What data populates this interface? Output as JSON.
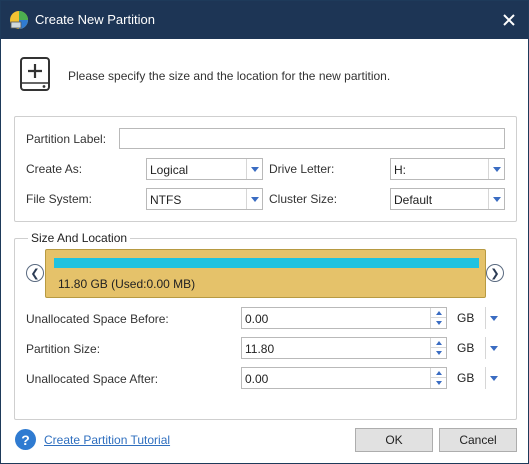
{
  "window": {
    "title": "Create New Partition",
    "close_icon": "close-icon",
    "title_icon": "partition-wizard-icon"
  },
  "header": {
    "icon": "add-disk-icon",
    "text": "Please specify the size and the location for the new partition."
  },
  "settings": {
    "partition_label_label": "Partition Label:",
    "partition_label_value": "",
    "create_as_label": "Create As:",
    "create_as_value": "Logical",
    "drive_letter_label": "Drive Letter:",
    "drive_letter_value": "H:",
    "file_system_label": "File System:",
    "file_system_value": "NTFS",
    "cluster_size_label": "Cluster Size:",
    "cluster_size_value": "Default"
  },
  "size_location": {
    "legend": "Size And Location",
    "partition_info": "11.80 GB (Used:0.00 MB)",
    "used_fraction": 1.0,
    "bar_color": "#1fc2e0",
    "box_color": "#e5c26a",
    "unallocated_before_label": "Unallocated Space Before:",
    "unallocated_before_value": "0.00",
    "unallocated_before_unit": "GB",
    "partition_size_label": "Partition Size:",
    "partition_size_value": "11.80",
    "partition_size_unit": "GB",
    "unallocated_after_label": "Unallocated Space After:",
    "unallocated_after_value": "0.00",
    "unallocated_after_unit": "GB"
  },
  "footer": {
    "help_icon": "help-icon",
    "tutorial_link": "Create Partition Tutorial",
    "ok_label": "OK",
    "cancel_label": "Cancel"
  },
  "colors": {
    "titlebar": "#1d3555",
    "accent": "#3a6cc2",
    "link": "#2f6fbf"
  }
}
